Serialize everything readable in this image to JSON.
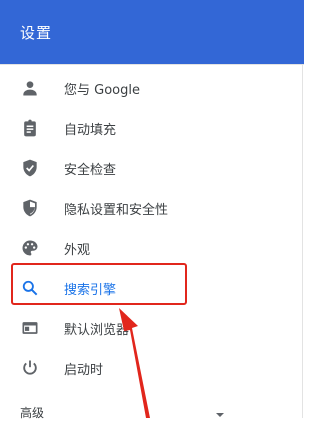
{
  "header": {
    "title": "设置",
    "color": "#3367d6"
  },
  "nav": {
    "items": [
      {
        "label": "您与 Google",
        "icon": "person-icon"
      },
      {
        "label": "自动填充",
        "icon": "clipboard-icon"
      },
      {
        "label": "安全检查",
        "icon": "shield-check-icon"
      },
      {
        "label": "隐私设置和安全性",
        "icon": "shield-half-icon"
      },
      {
        "label": "外观",
        "icon": "palette-icon"
      },
      {
        "label": "搜索引擎",
        "icon": "search-icon",
        "active": true
      },
      {
        "label": "默认浏览器",
        "icon": "browser-window-icon"
      },
      {
        "label": "启动时",
        "icon": "power-icon"
      }
    ],
    "active_color": "#1a73e8",
    "icon_color": "#5f6368"
  },
  "advanced": {
    "label": "高级",
    "icon": "chevron-down-icon"
  },
  "annotation": {
    "highlight_color": "#e1261c"
  }
}
